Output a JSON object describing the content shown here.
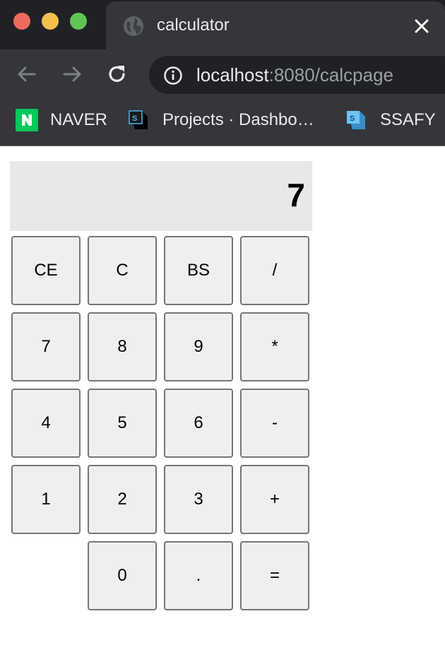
{
  "browser": {
    "tab_title": "calculator",
    "url_host": "localhost",
    "url_path": ":8080/calcpage",
    "bookmarks": [
      {
        "label": "NAVER",
        "icon": "naver-icon"
      },
      {
        "label": "Projects · Dashbo…",
        "icon": "project-icon"
      },
      {
        "label": "SSAFY",
        "icon": "ssafy-icon"
      }
    ]
  },
  "calculator": {
    "display": "7",
    "keys": [
      "CE",
      "C",
      "BS",
      "/",
      "7",
      "8",
      "9",
      "*",
      "4",
      "5",
      "6",
      "-",
      "1",
      "2",
      "3",
      "+",
      "0",
      ".",
      "="
    ]
  },
  "colors": {
    "tabstrip": "#202124",
    "toolbar": "#35363a",
    "display_bg": "#e8e8e8",
    "key_bg": "#efefef",
    "key_border": "#767676"
  }
}
